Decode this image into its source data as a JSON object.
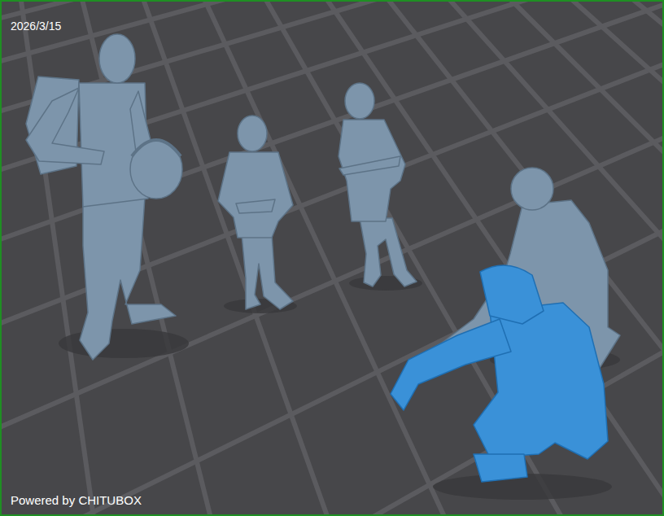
{
  "viewport": {
    "date": "2026/3/15",
    "watermark": "Powered by CHITUBOX"
  },
  "models": [
    {
      "selected": false
    },
    {
      "selected": false
    },
    {
      "selected": false
    },
    {
      "selected": false
    },
    {
      "selected": true
    }
  ]
}
